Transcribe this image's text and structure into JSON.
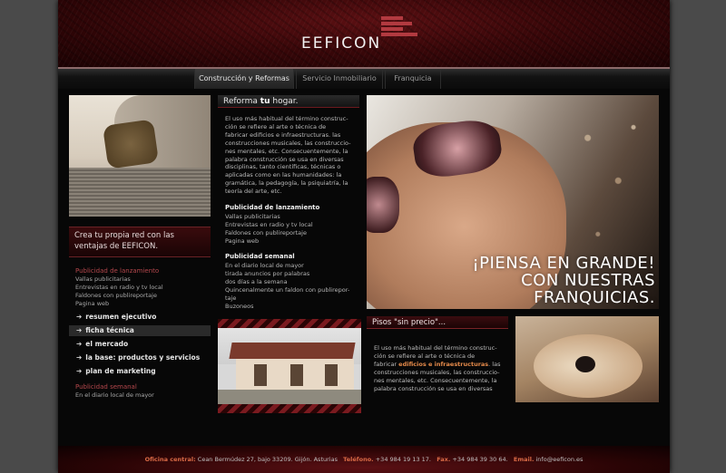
{
  "brand": {
    "logo_text": "EEFICON",
    "accent": "#b23a40"
  },
  "nav": {
    "items": [
      {
        "label": "Construcción y Reformas"
      },
      {
        "label": "Servicio Inmobiliario"
      },
      {
        "label": "Franquicia"
      }
    ]
  },
  "left": {
    "promo": "Crea tu propia red con las ventajas de EEFICON.",
    "section1": {
      "title": "Publicidad de lanzamiento",
      "lines": [
        "Vallas publicitarias",
        "Entrevistas en radio y tv local",
        "Faldones con publireportaje",
        "Pagina web"
      ]
    },
    "menu": [
      {
        "label": "resumen ejecutivo"
      },
      {
        "label": "ficha técnica"
      },
      {
        "label": "el mercado"
      },
      {
        "label": "la base: productos y servicios"
      },
      {
        "label": "plan de marketing"
      }
    ],
    "section2": {
      "title": "Publicidad semanal",
      "lines": [
        "En el diario local de mayor"
      ]
    }
  },
  "middle": {
    "title_pre": "Reforma",
    "title_bold": "tu",
    "title_post": "hogar.",
    "intro_lines": [
      "El uso más habitual del término construc-",
      "ción se refiere al arte o técnica de",
      "fabricar edificios e infraestructuras. las",
      "construcciones musicales, las construccio-",
      "nes mentales, etc. Consecuentemente, la",
      "palabra construcción se usa en diversas",
      "disciplinas, tanto científicas, técnicas o",
      "aplicadas como en las humanidades: la",
      "gramática, la pedagogía, la psiquiatría, la",
      "teoría del arte, etc."
    ],
    "block1": {
      "title": "Publicidad de lanzamiento",
      "lines": [
        "Vallas publicitarias",
        "Entrevistas en radio y tv local",
        "Faldones con publireportaje",
        "Pagina web"
      ]
    },
    "block2": {
      "title": "Publicidad semanal",
      "lines": [
        "En el diario local de mayor",
        "tirada anuncios por palabras",
        "dos días a la semana",
        "Quincenalmente un faldon con publirepor-",
        "taje",
        "Buzoneos"
      ]
    }
  },
  "hero": {
    "slogan": [
      "¡PIENSA EN GRANDE!",
      "CON NUESTRAS",
      "FRANQUICIAS."
    ]
  },
  "pisos": {
    "title": "Pisos \"sin precio\"...",
    "lines_pre": [
      "El uso más habitual del término construc-",
      "ción se refiere al arte o técnica de"
    ],
    "line3_pre": "fabricar ",
    "line3_hl": "edificios e infraestructuras",
    "line3_post": ". las",
    "lines_post": [
      "construcciones musicales, las construccio-",
      "nes mentales, etc. Consecuentemente, la",
      "palabra construcción se usa en diversas"
    ]
  },
  "footer": {
    "office_label": "Oficina central:",
    "address": "Cean Bermúdez 27, bajo   33209. Gijón. Asturias",
    "phone_label": "Teléfono.",
    "phone": "+34 984 19 13 17.",
    "fax_label": "Fax.",
    "fax": "+34 984 39 30 64.",
    "email_label": "Email.",
    "email": "info@eeficon.es"
  }
}
